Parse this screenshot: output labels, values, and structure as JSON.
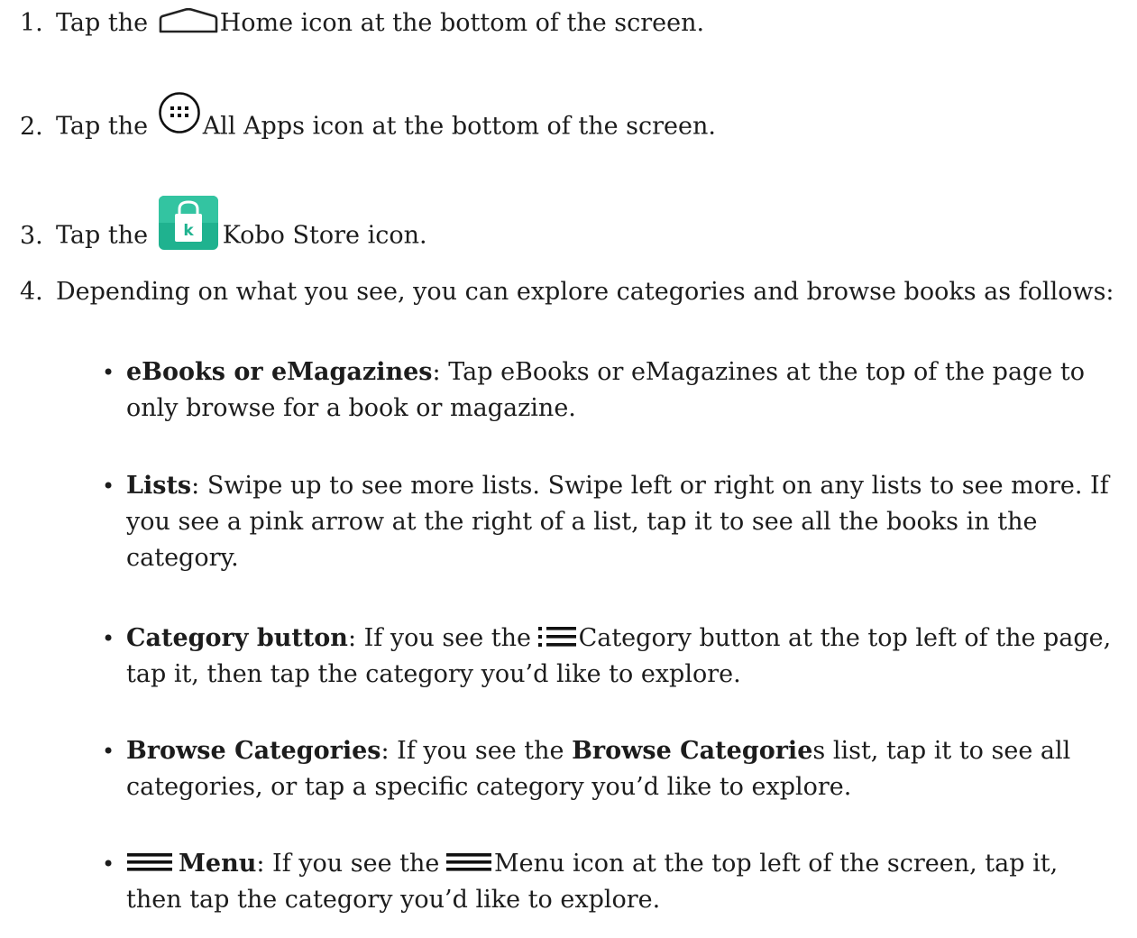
{
  "steps": [
    {
      "number": "1.",
      "before": "Tap the",
      "icon": "home-icon",
      "after": "Home icon at the bottom of the screen."
    },
    {
      "number": "2.",
      "before": "Tap the",
      "icon": "all-apps-icon",
      "after": "All Apps icon at the bottom of the screen."
    },
    {
      "number": "3.",
      "before": "Tap the",
      "icon": "kobo-store-icon",
      "after": "Kobo Store icon."
    },
    {
      "number": "4.",
      "text": "Depending on what you see, you can explore categories and browse books as follows:"
    }
  ],
  "kobo_icon_letter": "k",
  "bullets": [
    {
      "term": "eBooks or eMagazines",
      "sep": ":",
      "text": "Tap eBooks or eMagazines at the top of the page to only browse for a book or magazine."
    },
    {
      "term": "Lists",
      "sep": ":",
      "text": "Swipe up to see more lists. Swipe left or right on any lists to see more. If you see a pink arrow at the right of a list, tap it to see all the books in the category."
    },
    {
      "term": "Category button",
      "sep": ":",
      "before": "If you see the",
      "icon": "category-list-icon",
      "after": "Category button at the top left of the page, tap it, then tap the category you’d like to explore."
    },
    {
      "term": "Browse Categories",
      "sep": ":",
      "before": "If you see the",
      "inline_bold": "Browse Categorie",
      "after": "s list, tap it to see all categories, or tap a specific category you’d like to explore."
    },
    {
      "icon": "menu-icon",
      "term": "Menu",
      "sep": ":",
      "before": "If you see the",
      "icon2": "menu-icon",
      "after": "Menu icon at the top left of the screen, tap it, then tap the category you’d like to explore."
    }
  ],
  "colors": {
    "text": "#1c1c1c",
    "kobo_green": "#1fb28f",
    "icon_stroke": "#222222"
  }
}
